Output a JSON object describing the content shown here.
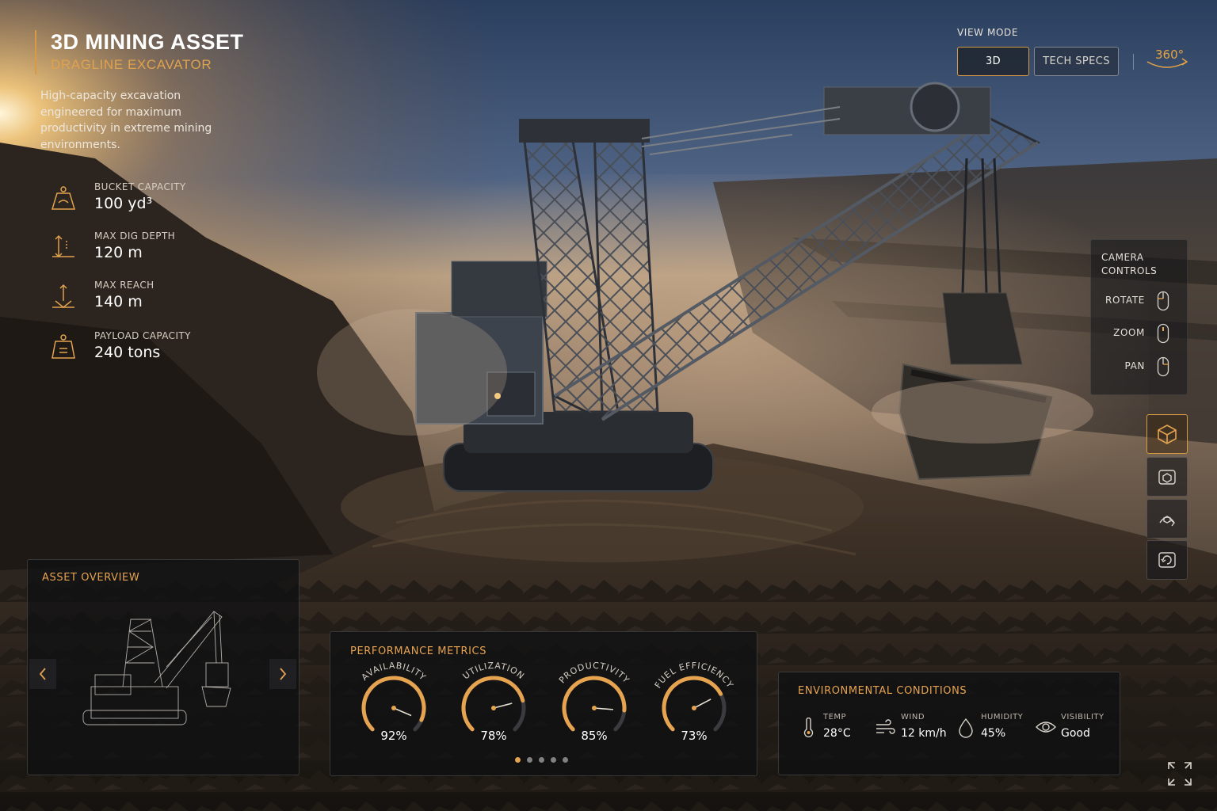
{
  "header": {
    "title": "3D MINING ASSET",
    "subtitle": "DRAGLINE EXCAVATOR",
    "description": "High-capacity excavation engineered for maximum productivity in extreme mining environments."
  },
  "specs": [
    {
      "icon": "bucket-weight-icon",
      "label": "BUCKET CAPACITY",
      "value": "100 yd³"
    },
    {
      "icon": "dig-depth-icon",
      "label": "MAX DIG DEPTH",
      "value": "120 m"
    },
    {
      "icon": "reach-icon",
      "label": "MAX REACH",
      "value": "140 m"
    },
    {
      "icon": "payload-icon",
      "label": "PAYLOAD CAPACITY",
      "value": "240 tons"
    }
  ],
  "view_mode": {
    "label": "VIEW MODE",
    "options": [
      "3D",
      "TECH SPECS"
    ],
    "selected": "3D",
    "rotate_label": "360°"
  },
  "camera": {
    "title": "CAMERA CONTROLS",
    "controls": [
      {
        "label": "ROTATE",
        "icon": "mouse-left-icon"
      },
      {
        "label": "ZOOM",
        "icon": "mouse-scroll-icon"
      },
      {
        "label": "PAN",
        "icon": "mouse-right-icon"
      }
    ]
  },
  "tools": [
    {
      "icon": "cube-icon",
      "active": true
    },
    {
      "icon": "box-view-icon",
      "active": false
    },
    {
      "icon": "orbit-icon",
      "active": false
    },
    {
      "icon": "reset-view-icon",
      "active": false
    }
  ],
  "asset_overview": {
    "title": "ASSET OVERVIEW"
  },
  "performance": {
    "title": "PERFORMANCE METRICS",
    "metrics": [
      {
        "label": "AVAILABILITY",
        "value": 92,
        "display": "92%"
      },
      {
        "label": "UTILIZATION",
        "value": 78,
        "display": "78%"
      },
      {
        "label": "PRODUCTIVITY",
        "value": 85,
        "display": "85%"
      },
      {
        "label": "FUEL EFFICIENCY",
        "value": 73,
        "display": "73%"
      }
    ],
    "page_count": 5,
    "current_page": 1
  },
  "environment": {
    "title": "ENVIRONMENTAL CONDITIONS",
    "items": [
      {
        "icon": "thermometer-icon",
        "label": "TEMP",
        "value": "28°C"
      },
      {
        "icon": "wind-icon",
        "label": "WIND",
        "value": "12 km/h"
      },
      {
        "icon": "humidity-icon",
        "label": "HUMIDITY",
        "value": "45%"
      },
      {
        "icon": "visibility-icon",
        "label": "VISIBILITY",
        "value": "Good"
      }
    ]
  },
  "colors": {
    "accent": "#e6a350",
    "panel": "#0e0f12"
  }
}
